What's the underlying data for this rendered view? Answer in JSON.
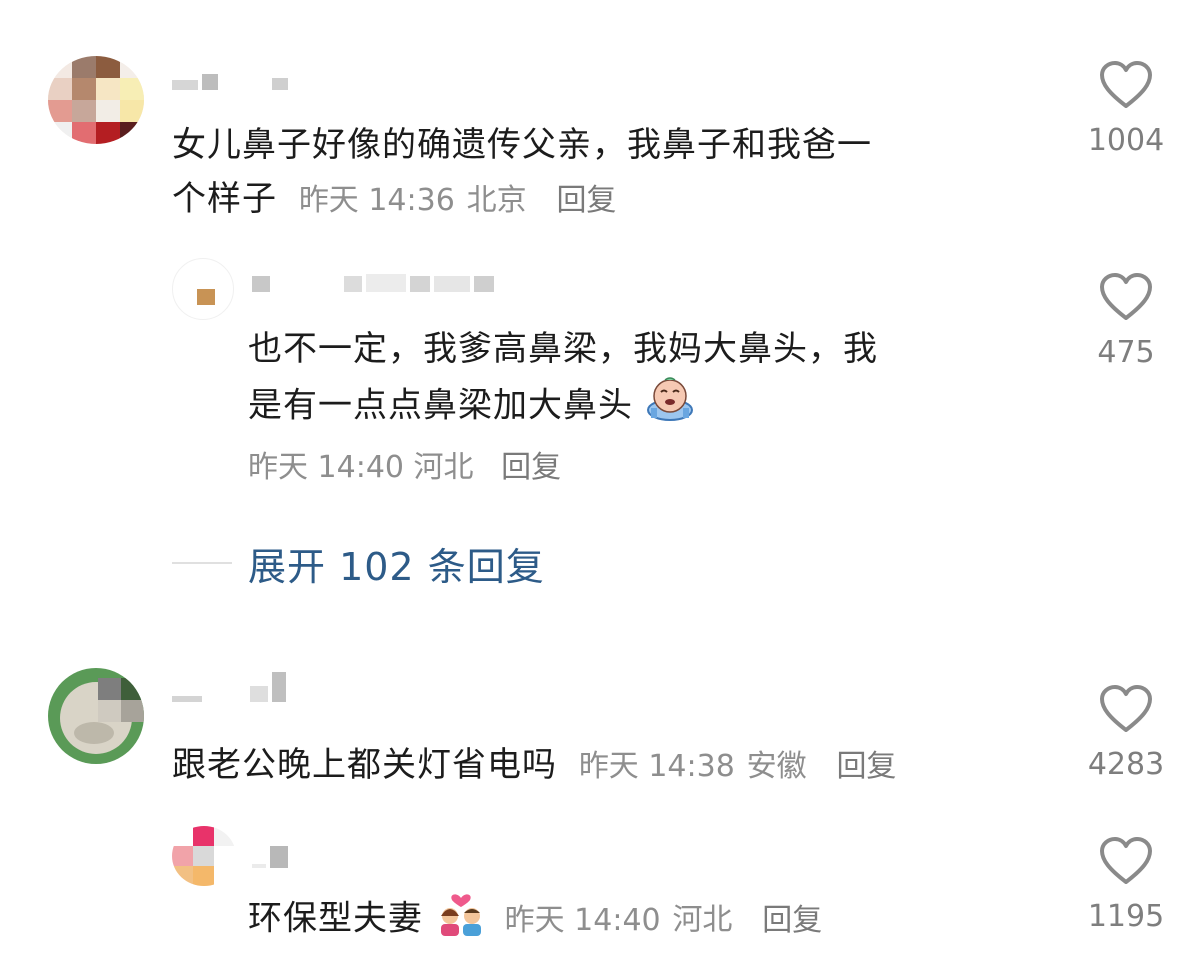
{
  "comments": [
    {
      "text_line1": "女儿鼻子好像的确遗传父亲，我鼻子和我爸一",
      "text_line2": "个样子",
      "time": "昨天 14:36",
      "location": "北京",
      "reply": "回复",
      "likes": "1004"
    },
    {
      "text_line1": "也不一定，我爹高鼻梁，我妈大鼻头，我",
      "text_line2": "是有一点点鼻梁加大鼻头",
      "emoji": "crying-face-emoji",
      "time": "昨天 14:40",
      "location": "河北",
      "reply": "回复",
      "likes": "475"
    },
    {
      "text": "跟老公晚上都关灯省电吗",
      "time": "昨天 14:38",
      "location": "安徽",
      "reply": "回复",
      "likes": "4283"
    },
    {
      "text": "环保型夫妻",
      "emoji": "couple-with-heart-emoji",
      "time": "昨天 14:40",
      "location": "河北",
      "reply": "回复",
      "likes": "1195"
    }
  ],
  "expand_replies": "展开 102 条回复",
  "icons": {
    "like": "heart-outline-icon"
  },
  "colors": {
    "link": "#2d5b88",
    "meta": "#8e8e8e",
    "heart": "#8a8a8a"
  }
}
